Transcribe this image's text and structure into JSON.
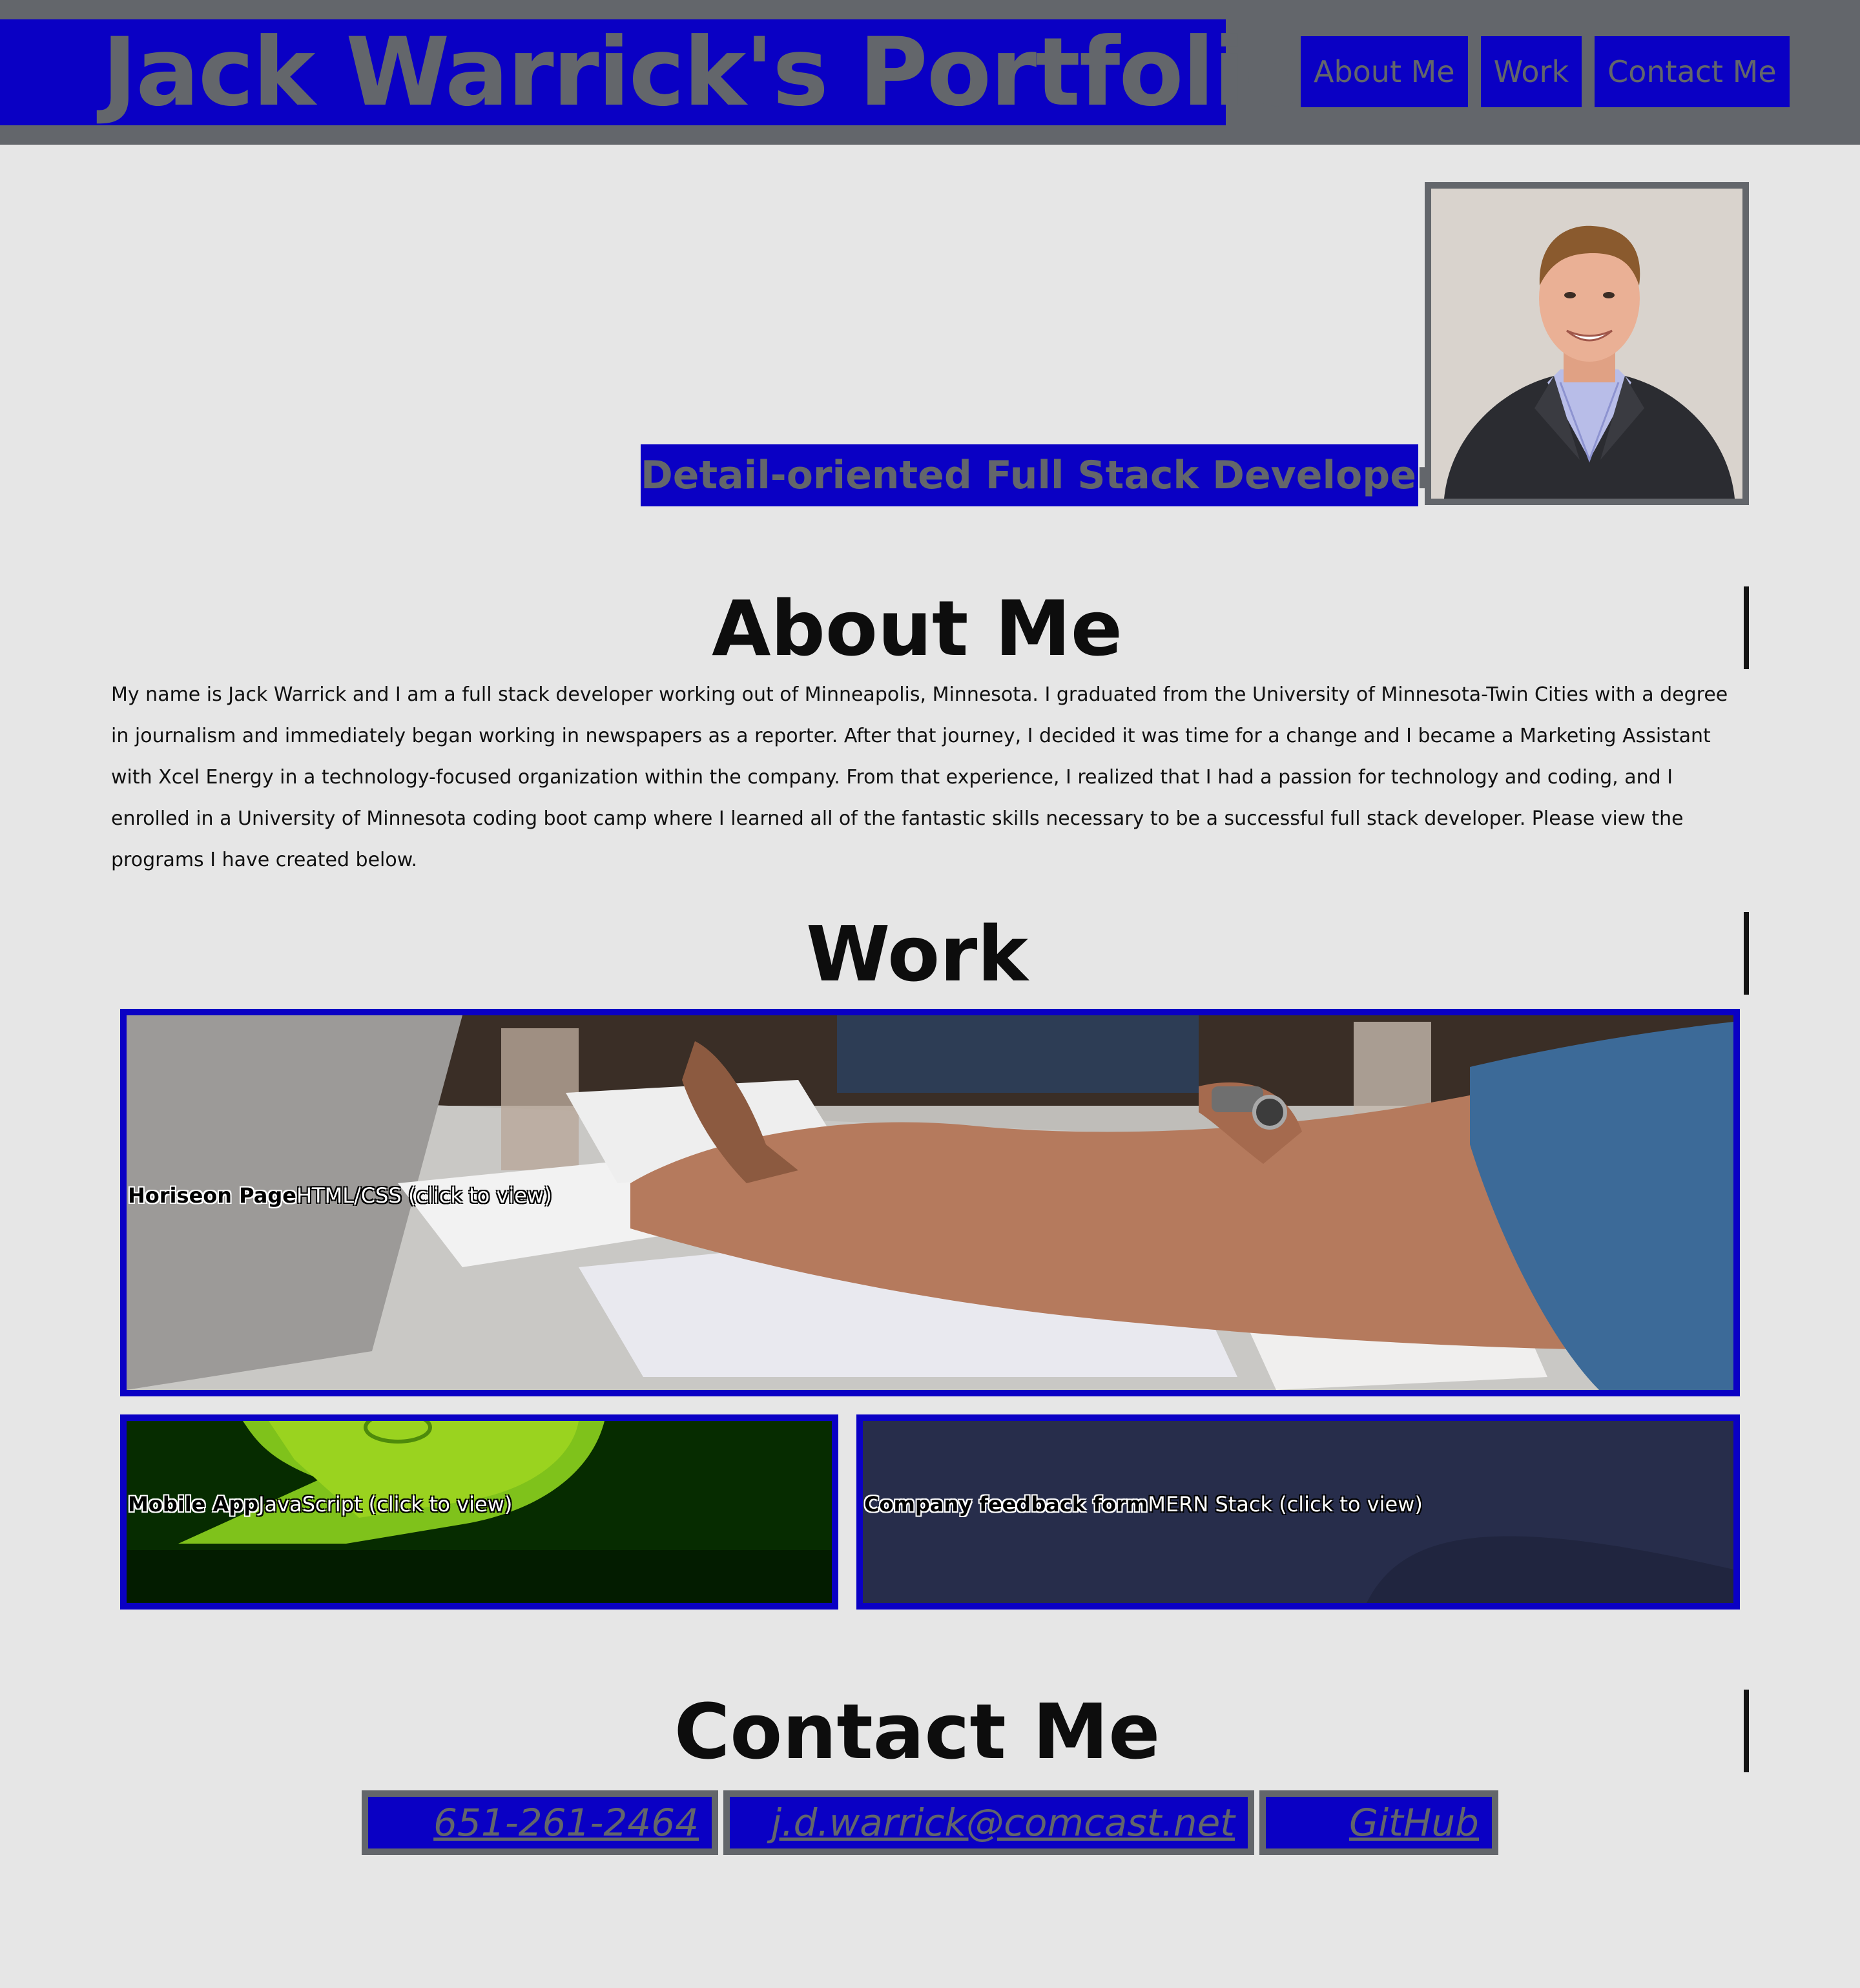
{
  "header": {
    "title": "Jack Warrick's Portfolio",
    "nav": [
      {
        "label": "About Me"
      },
      {
        "label": "Work"
      },
      {
        "label": "Contact Me"
      }
    ]
  },
  "hero": {
    "tagline": "Detail-oriented Full Stack Developer"
  },
  "about": {
    "heading": "About Me",
    "text": "My name is Jack Warrick and I am a full stack developer working out of Minneapolis, Minnesota. I graduated from the University of Minnesota-Twin Cities with a degree in journalism and immediately began working in newspapers as a reporter. After that journey, I decided it was time for a change and I became a Marketing Assistant with Xcel Energy in a technology-focused organization within the company. From that experience, I realized that I had a passion for technology and coding, and I enrolled in a University of Minnesota coding boot camp where I learned all of the fantastic skills necessary to be a successful full stack developer. Please view the programs I have created below."
  },
  "work": {
    "heading": "Work",
    "projects": [
      {
        "name": "Horiseon Page",
        "tech": "HTML/CSS (click to view)"
      },
      {
        "name": "Mobile App",
        "tech": "JavaScript (click to view)"
      },
      {
        "name": "Company feedback form",
        "tech": "MERN Stack (click to view)"
      }
    ]
  },
  "contact": {
    "heading": "Contact Me",
    "phone": "651-261-2464",
    "email": "j.d.warrick@comcast.net",
    "github": "GitHub"
  },
  "colors": {
    "accent": "#0a00c4",
    "header_bg": "#63666b",
    "page_bg": "#e6e6e6"
  }
}
